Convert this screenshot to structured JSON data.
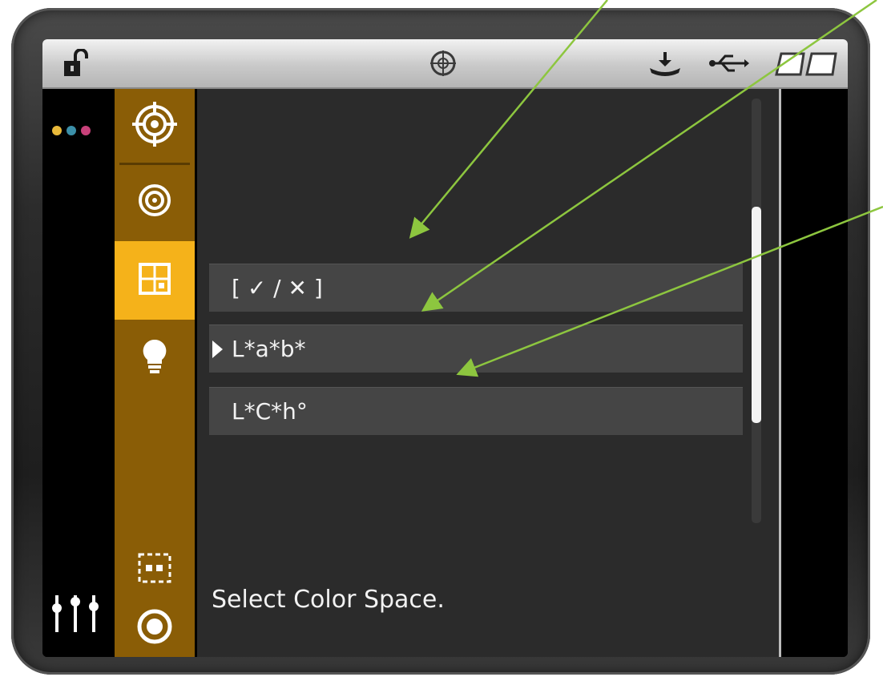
{
  "topbar": {
    "left_icon": "unlocked-padlock-icon",
    "center_icon": "target-crosshair-icon",
    "right_icons": [
      "download-tray-icon",
      "usb-icon",
      "dual-card-icon"
    ]
  },
  "indicator_dots": {
    "colors": [
      "#e8b93a",
      "#3b8fa8",
      "#c8417a"
    ]
  },
  "sidebar": {
    "items": [
      {
        "icon": "target-measure-icon"
      },
      {
        "icon": "concentric-circles-icon"
      },
      {
        "icon": "grid-settings-icon",
        "active": true
      },
      {
        "icon": "lightbulb-icon"
      },
      {
        "icon": "dashed-box-icon"
      },
      {
        "icon": "ring-icon"
      }
    ],
    "active_color": "#f5b21a",
    "background_color": "#8a5d06"
  },
  "bottom_left_icon": "mixer-sliders-icon",
  "menu": {
    "items": [
      {
        "label": "[ ✓ / ✕ ]",
        "selected": false
      },
      {
        "label": "L*a*b*",
        "selected": true
      },
      {
        "label": "L*C*h°",
        "selected": false
      }
    ]
  },
  "status_text": "Select Color Space.",
  "annotation_color": "#8dc63f"
}
